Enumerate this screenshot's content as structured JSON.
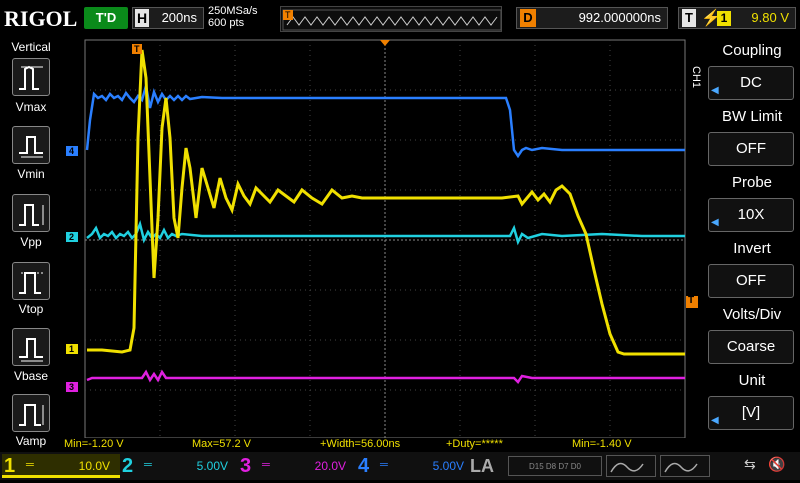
{
  "header": {
    "brand": "RIGOL",
    "trigger_status": "T'D",
    "timebase_key": "H",
    "timebase_value": "200ns",
    "sample_rate": "250MSa/s",
    "memory_depth": "600 pts",
    "delay_key": "D",
    "delay_value": "992.000000ns",
    "trigger_key": "T",
    "trigger_source": "1",
    "trigger_level": "9.80 V"
  },
  "left_panel": {
    "title": "Vertical",
    "items": [
      {
        "label": "Vmax"
      },
      {
        "label": "Vmin"
      },
      {
        "label": "Vpp"
      },
      {
        "label": "Vtop"
      },
      {
        "label": "Vbase"
      },
      {
        "label": "Vamp"
      }
    ]
  },
  "right_menu": {
    "channel_tag": "CH1",
    "items": [
      {
        "title": "Coupling",
        "value": "DC",
        "has_arrow": true
      },
      {
        "title": "BW Limit",
        "value": "OFF",
        "has_arrow": false
      },
      {
        "title": "Probe",
        "value": "10X",
        "has_arrow": true
      },
      {
        "title": "Invert",
        "value": "OFF",
        "has_arrow": false
      },
      {
        "title": "Volts/Div",
        "value": "Coarse",
        "has_arrow": false
      },
      {
        "title": "Unit",
        "value": "[V]",
        "has_arrow": true
      }
    ]
  },
  "measurements": {
    "min1": "Min=-1.20 V",
    "max1": "Max=57.2 V",
    "width": "+Width=56.00ns",
    "duty": "+Duty=*****",
    "min2": "Min=-1.40 V"
  },
  "channels": [
    {
      "num": "1",
      "coupling": "═",
      "scale": "10.0V",
      "color": "#f0e000"
    },
    {
      "num": "2",
      "coupling": "═",
      "scale": "5.00V",
      "color": "#20d0e0"
    },
    {
      "num": "3",
      "coupling": "═",
      "scale": "20.0V",
      "color": "#e020e0"
    },
    {
      "num": "4",
      "coupling": "═",
      "scale": "5.00V",
      "color": "#2a7fff"
    }
  ],
  "trace_markers": {
    "ch1": "1",
    "ch2": "2",
    "ch3": "3",
    "ch4": "4",
    "trigger_pos": "T",
    "trigger_level_marker": "T"
  },
  "bottom_right": {
    "la": "LA",
    "la_grid": "D15 D8 D7 D0"
  },
  "colors": {
    "ch1": "#f0e000",
    "ch2": "#20d0e0",
    "ch3": "#e020e0",
    "ch4": "#2a7fff",
    "trigger": "#f08000",
    "accent": "#0a8a1a"
  }
}
